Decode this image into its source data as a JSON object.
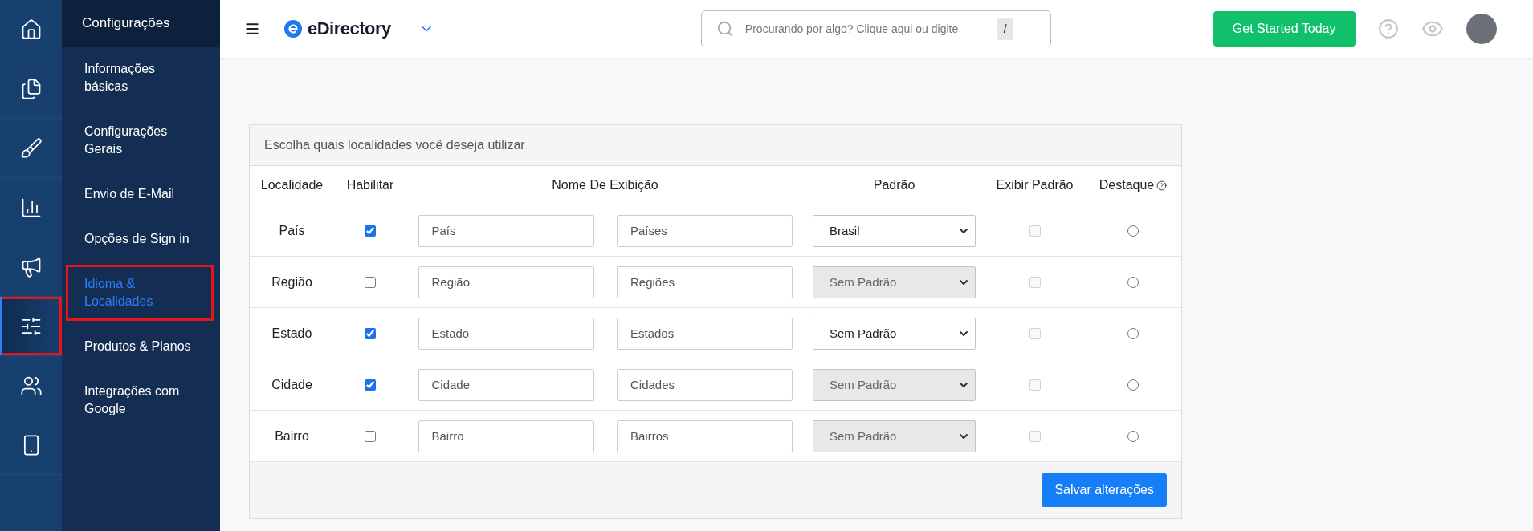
{
  "rail": [
    {
      "kind": "home",
      "selected": false
    },
    {
      "kind": "documents",
      "selected": false
    },
    {
      "kind": "brush",
      "selected": false
    },
    {
      "kind": "chart",
      "selected": false
    },
    {
      "kind": "megaphone",
      "selected": false
    },
    {
      "kind": "sliders",
      "selected": true
    },
    {
      "kind": "users",
      "selected": false
    },
    {
      "kind": "phone",
      "selected": false
    }
  ],
  "submenu": {
    "title": "Configurações",
    "items": [
      {
        "label": "Informações básicas",
        "selected": false
      },
      {
        "label": "Configurações Gerais",
        "selected": false
      },
      {
        "label": "Envio de E-Mail",
        "selected": false
      },
      {
        "label": "Opções de Sign in",
        "selected": false
      },
      {
        "label": "Idioma & Localidades",
        "selected": true
      },
      {
        "label": "Produtos & Planos",
        "selected": false
      },
      {
        "label": "Integrações com Google",
        "selected": false
      }
    ]
  },
  "topbar": {
    "brand": "eDirectory",
    "search": {
      "placeholder": "Procurando por algo? Clique aqui ou digite",
      "shortcut": "/"
    },
    "cta": "Get Started Today"
  },
  "card": {
    "title": "Escolha quais localidades você deseja utilizar",
    "columns": [
      {
        "label": "Localidade",
        "help": false
      },
      {
        "label": "Habilitar",
        "help": false
      },
      {
        "label": "Nome De Exibição",
        "help": false
      },
      {
        "label": "Padrão",
        "help": false
      },
      {
        "label": "Exibir Padrão",
        "help": false
      },
      {
        "label": "Destaque",
        "help": true
      }
    ],
    "rows": [
      {
        "label": "País",
        "enabled": true,
        "singular": "País",
        "plural": "Países",
        "default": "Brasil",
        "default_disabled": false,
        "show_default": false,
        "show_default_disabled": true,
        "featured": false
      },
      {
        "label": "Região",
        "enabled": false,
        "singular": "Região",
        "plural": "Regiões",
        "default": "Sem Padrão",
        "default_disabled": true,
        "show_default": false,
        "show_default_disabled": true,
        "featured": false
      },
      {
        "label": "Estado",
        "enabled": true,
        "singular": "Estado",
        "plural": "Estados",
        "default": "Sem Padrão",
        "default_disabled": false,
        "show_default": false,
        "show_default_disabled": true,
        "featured": false
      },
      {
        "label": "Cidade",
        "enabled": true,
        "singular": "Cidade",
        "plural": "Cidades",
        "default": "Sem Padrão",
        "default_disabled": true,
        "show_default": false,
        "show_default_disabled": true,
        "featured": false
      },
      {
        "label": "Bairro",
        "enabled": false,
        "singular": "Bairro",
        "plural": "Bairros",
        "default": "Sem Padrão",
        "default_disabled": true,
        "show_default": false,
        "show_default_disabled": true,
        "featured": false
      }
    ],
    "save": "Salvar alterações"
  }
}
